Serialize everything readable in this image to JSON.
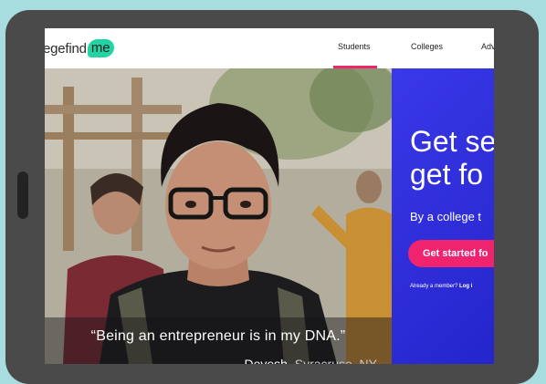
{
  "logo": {
    "text": "egefind",
    "blob": "me"
  },
  "nav": {
    "items": [
      "Students",
      "Colleges",
      "Adv"
    ],
    "active": "Students"
  },
  "hero": {
    "quote": "“Being an entrepreneur is in my DNA.”",
    "name": "Devesh,",
    "place": "Syracruse, NY",
    "slides": 4,
    "active_slide": 2
  },
  "cta": {
    "headline_line1": "Get se",
    "headline_line2": "get fo",
    "tagline": "By a college t",
    "button": "Get started fo",
    "member_prefix": "Already a member?",
    "member_link": "Log i"
  },
  "colors": {
    "background": "#a8dde0",
    "device": "#4a4a4a",
    "accent": "#f0236e",
    "panel": "#2b2bd6",
    "logo_blob": "#22d4a4"
  }
}
